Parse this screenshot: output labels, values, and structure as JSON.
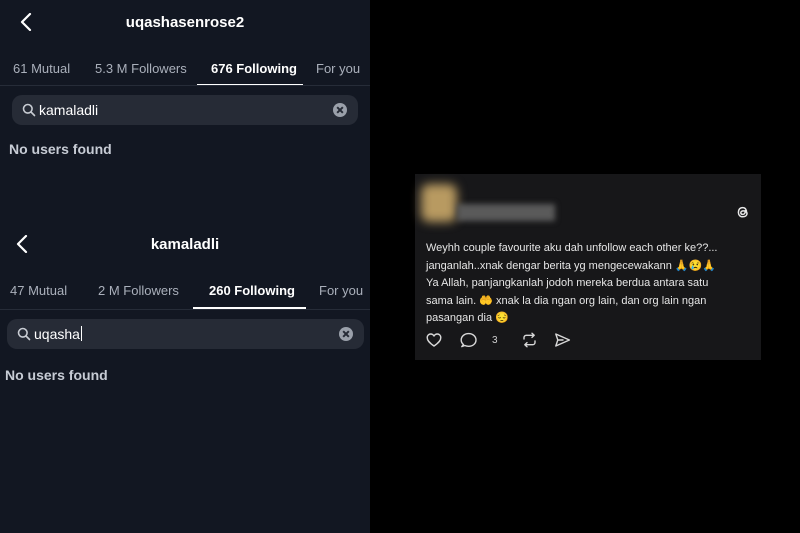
{
  "panel1": {
    "username": "uqashasenrose2",
    "tabs": [
      {
        "label": "61 Mutual",
        "active": false
      },
      {
        "label": "5.3 M Followers",
        "active": false
      },
      {
        "label": "676 Following",
        "active": true
      },
      {
        "label": "For you",
        "active": false
      }
    ],
    "search_value": "kamaladli",
    "empty_message": "No users found"
  },
  "panel2": {
    "username": "kamaladli",
    "tabs": [
      {
        "label": "47 Mutual",
        "active": false
      },
      {
        "label": "2 M Followers",
        "active": false
      },
      {
        "label": "260 Following",
        "active": true
      },
      {
        "label": "For you",
        "active": false
      }
    ],
    "search_value": "uqasha",
    "empty_message": "No users found"
  },
  "thread_post": {
    "line1": "Weyhh couple favourite aku dah unfollow each other ke??...",
    "line2": "janganlah..xnak dengar berita yg mengecewakann",
    "line2_emojis": "🙏😢🙏",
    "line3": "Ya Allah, panjangkanlah jodoh mereka berdua antara satu",
    "line4_a": "sama lain.",
    "line4_emoji": "🤲",
    "line4_b": " xnak la dia ngan org lain, dan org lain ngan",
    "line5": "pasangan dia",
    "line5_emoji": "😔",
    "reply_count": "3"
  },
  "colors": {
    "app_background": "#121722",
    "search_background": "#262b36",
    "card_background": "#171719",
    "page_background": "#000000"
  },
  "icons": [
    "back-arrow-icon",
    "search-icon",
    "clear-icon",
    "threads-logo-icon",
    "heart-icon",
    "comment-icon",
    "repost-icon",
    "share-icon"
  ]
}
